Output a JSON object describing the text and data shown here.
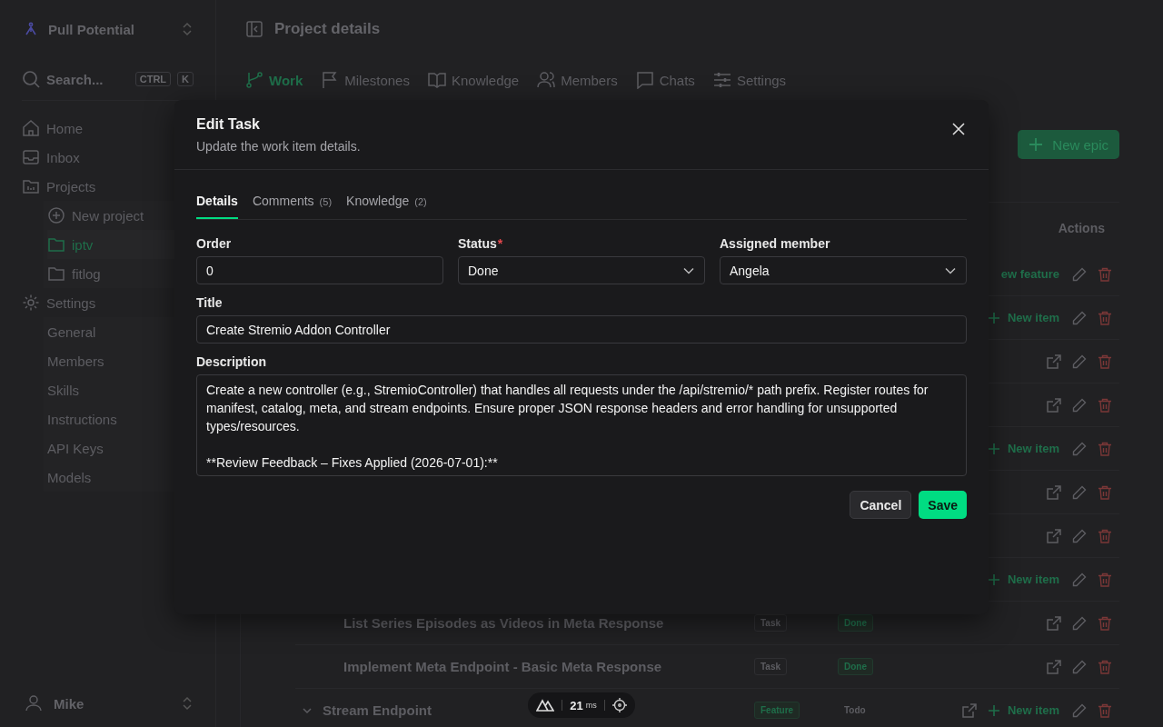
{
  "workspace": {
    "name": "Pull Potential"
  },
  "search": {
    "placeholder": "Search...",
    "keys": [
      "CTRL",
      "K"
    ]
  },
  "nav": [
    {
      "label": "Home"
    },
    {
      "label": "Inbox"
    },
    {
      "label": "Projects",
      "children": [
        {
          "label": "New project",
          "kind": "action",
          "selected": false
        },
        {
          "label": "iptv",
          "kind": "folder",
          "selected": true
        },
        {
          "label": "fitlog",
          "kind": "folder",
          "selected": false
        }
      ]
    },
    {
      "label": "Settings",
      "children": [
        {
          "label": "General",
          "kind": "link",
          "selected": false
        },
        {
          "label": "Members",
          "kind": "link",
          "selected": false
        },
        {
          "label": "Skills",
          "kind": "link",
          "selected": false
        },
        {
          "label": "Instructions",
          "kind": "link",
          "selected": false
        },
        {
          "label": "API Keys",
          "kind": "link",
          "selected": false
        },
        {
          "label": "Models",
          "kind": "link",
          "selected": false
        }
      ]
    }
  ],
  "user": {
    "name": "Mike"
  },
  "page": {
    "title": "Project details"
  },
  "tabs": [
    {
      "label": "Work",
      "selected": true
    },
    {
      "label": "Milestones",
      "selected": false
    },
    {
      "label": "Knowledge",
      "selected": false
    },
    {
      "label": "Members",
      "selected": false
    },
    {
      "label": "Chats",
      "selected": false
    },
    {
      "label": "Settings",
      "selected": false
    }
  ],
  "new_epic": "New epic",
  "table": {
    "actions_header": "Actions",
    "rows": [
      {
        "kind": "epic",
        "add_label": "ew feature"
      },
      {
        "kind": "feature",
        "add_label": "New item"
      },
      {
        "kind": "task",
        "external_link": true
      },
      {
        "kind": "task",
        "external_link": true
      },
      {
        "kind": "feature",
        "add_label": "New item"
      },
      {
        "kind": "task",
        "external_link": true
      },
      {
        "kind": "task",
        "external_link": true
      },
      {
        "kind": "feature",
        "add_label": "New item"
      },
      {
        "kind": "task",
        "title": "List Series Episodes as Videos in Meta Response",
        "type": "Task",
        "status": "Done",
        "external_link": true
      },
      {
        "kind": "task",
        "title": "Implement Meta Endpoint - Basic Meta Response",
        "type": "Task",
        "status": "Done",
        "external_link": true
      },
      {
        "kind": "feature",
        "title": "Stream Endpoint",
        "type": "Feature",
        "status": "Todo",
        "add_label": "New item",
        "external_link": true
      }
    ]
  },
  "dialog": {
    "title": "Edit Task",
    "subtitle": "Update the work item details.",
    "tabs": [
      {
        "label": "Details",
        "selected": true
      },
      {
        "label": "Comments",
        "count": "(5)",
        "selected": false
      },
      {
        "label": "Knowledge",
        "count": "(2)",
        "selected": false
      }
    ],
    "required_mark": "*",
    "fields": [
      {
        "label": "Order",
        "value": "0",
        "kind": "text",
        "required": false
      },
      {
        "label": "Status",
        "value": "Done",
        "kind": "select",
        "required": true
      },
      {
        "label": "Assigned member",
        "value": "Angela",
        "kind": "select",
        "required": false
      }
    ],
    "title_field": {
      "label": "Title",
      "value": "Create Stremio Addon Controller"
    },
    "description": {
      "label": "Description",
      "value": "Create a new controller (e.g., StremioController) that handles all requests under the /api/stremio/* path prefix. Register routes for manifest, catalog, meta, and stream endpoints. Ensure proper JSON response headers and error handling for unsupported types/resources.\n\n**Review Feedback – Fixes Applied (2026-07-01):**"
    },
    "buttons": {
      "cancel": "Cancel",
      "save": "Save"
    }
  },
  "devtools": {
    "value": "21",
    "unit": "ms"
  }
}
